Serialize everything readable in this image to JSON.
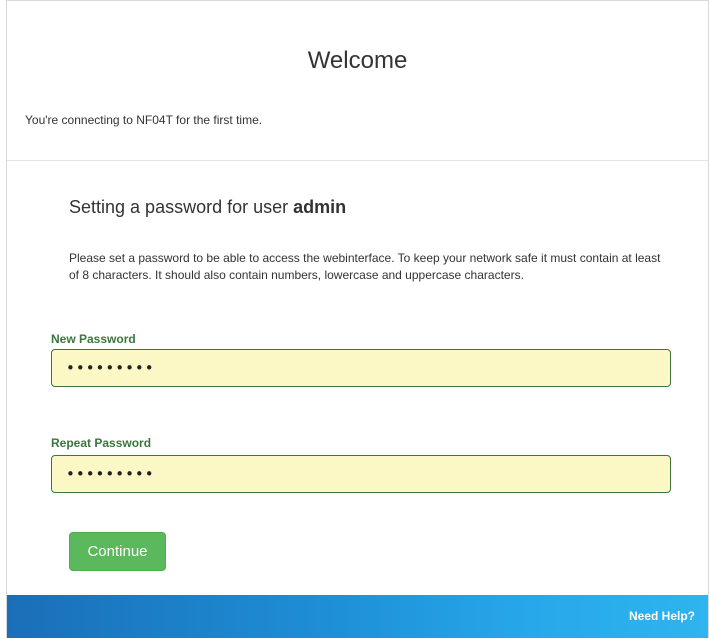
{
  "header": {
    "title": "Welcome"
  },
  "intro": {
    "text": "You're connecting to NF04T for the first time."
  },
  "section": {
    "title_prefix": "Setting a password for user ",
    "username": "admin",
    "description": "Please set a password to be able to access the webinterface. To keep your network safe it must contain at least of 8 characters. It should also contain numbers, lowercase and uppercase characters."
  },
  "form": {
    "new_password": {
      "label": "New Password",
      "value": "•••••••••"
    },
    "repeat_password": {
      "label": "Repeat Password",
      "value": "•••••••••"
    },
    "continue_label": "Continue"
  },
  "footer": {
    "help_label": "Need Help?"
  },
  "colors": {
    "accent_green": "#5cb85c",
    "label_green": "#3c763d",
    "input_fill": "#fcf8c6",
    "footer_blue": "#1e8ed6"
  }
}
